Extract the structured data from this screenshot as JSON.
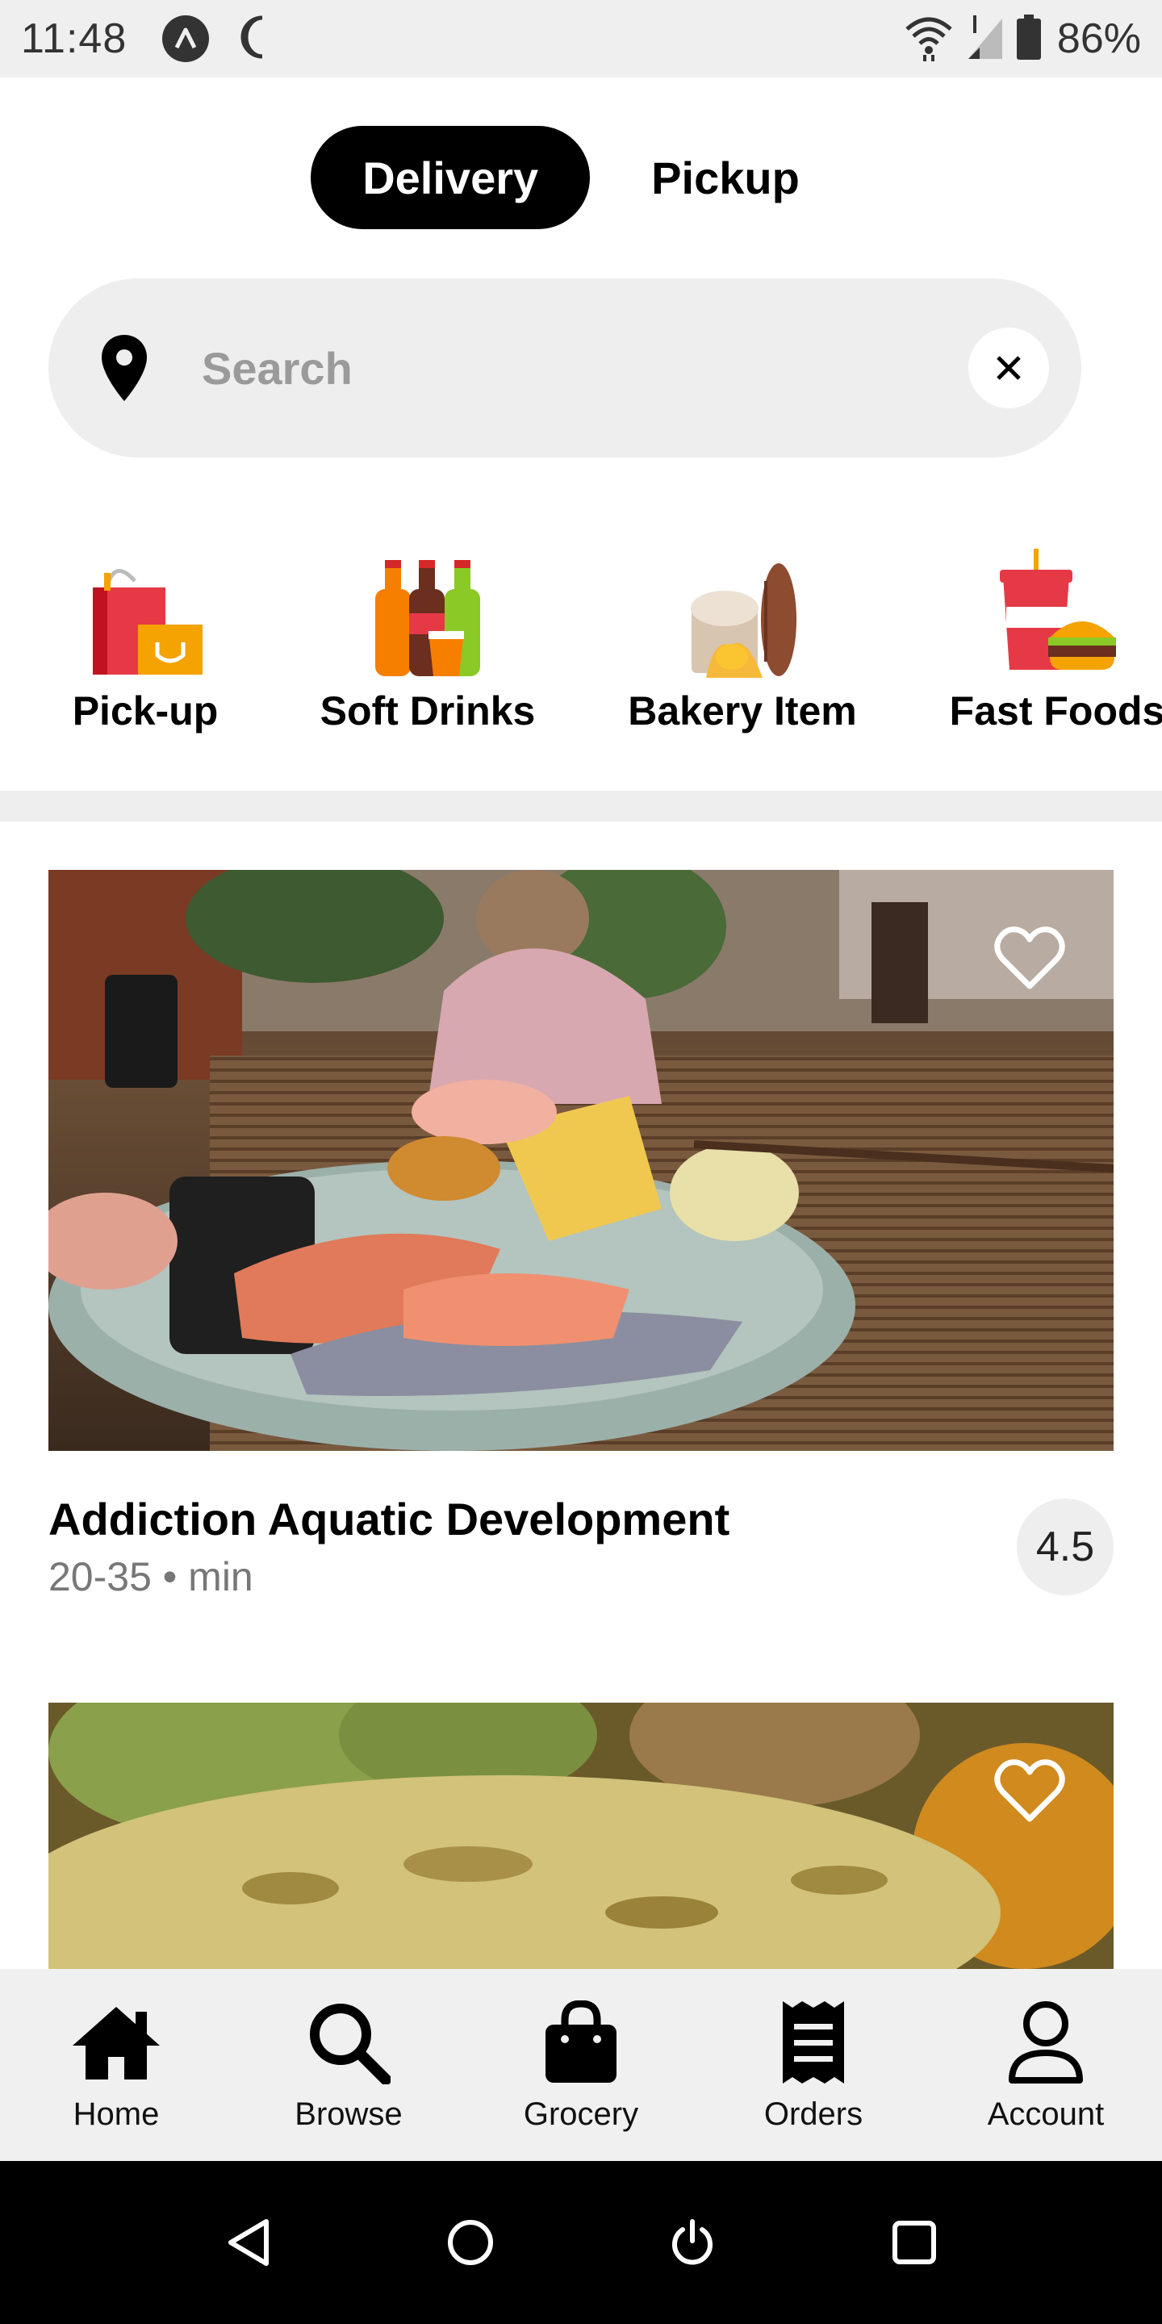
{
  "status_bar": {
    "time": "11:48",
    "battery": "86%"
  },
  "mode_tabs": {
    "delivery": "Delivery",
    "pickup": "Pickup",
    "active": "Delivery"
  },
  "search": {
    "placeholder": "Search"
  },
  "categories": [
    {
      "label": "Pick-up",
      "icon": "shopping-bags-icon"
    },
    {
      "label": "Soft Drinks",
      "icon": "soft-drink-bottles-icon"
    },
    {
      "label": "Bakery Item",
      "icon": "bread-icon"
    },
    {
      "label": "Fast Foods",
      "icon": "burger-soda-icon"
    }
  ],
  "restaurants": [
    {
      "name": "Addiction Aquatic Development",
      "time": "20-35 • min",
      "rating": "4.5",
      "image": "sushi-plate-photo"
    },
    {
      "name": "",
      "time": "",
      "rating": "",
      "image": "food-dish-photo"
    }
  ],
  "bottom_nav": [
    {
      "label": "Home",
      "icon": "home-icon"
    },
    {
      "label": "Browse",
      "icon": "search-icon"
    },
    {
      "label": "Grocery",
      "icon": "shopping-bag-icon"
    },
    {
      "label": "Orders",
      "icon": "receipt-icon"
    },
    {
      "label": "Account",
      "icon": "person-icon"
    }
  ],
  "colors": {
    "accent": "#000000",
    "surface": "#eeeeee",
    "muted_text": "#777777"
  }
}
